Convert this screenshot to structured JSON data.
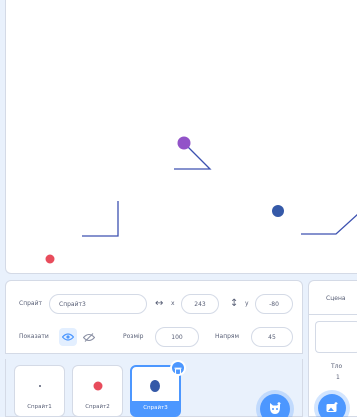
{
  "sprite_info": {
    "sprite_label": "Спрайт",
    "sprite_name": "Спрайт3",
    "x_label": "x",
    "x_value": "243",
    "y_label": "y",
    "y_value": "-80",
    "show_label": "Показати",
    "size_label": "Розмір",
    "size_value": "100",
    "direction_label": "Напрям",
    "direction_value": "45"
  },
  "sprites": [
    {
      "name": "Спрайт1",
      "costume_color": "#575e75",
      "selected": false
    },
    {
      "name": "Спрайт2",
      "costume_color": "#e84c5c",
      "selected": false
    },
    {
      "name": "Спрайт3",
      "costume_color": "#3559a8",
      "selected": true
    }
  ],
  "stage_panel": {
    "title": "Сцена",
    "backdrops_label": "Тло",
    "backdrops_count": "1"
  },
  "colors": {
    "accent": "#4c97ff",
    "stage_line": "#3d52b0",
    "purple_dot": "#9253c8",
    "red_dot": "#e84c5c",
    "blue_dot": "#3559a8"
  },
  "icons": {
    "eye": "eye-icon",
    "eye_hidden": "eye-hidden-icon",
    "horizontal_arrows": "horizontal-arrows-icon",
    "vertical_arrows": "vertical-arrows-icon",
    "trash": "trash-icon",
    "choose_sprite": "choose-sprite-icon",
    "choose_backdrop": "choose-backdrop-icon"
  }
}
